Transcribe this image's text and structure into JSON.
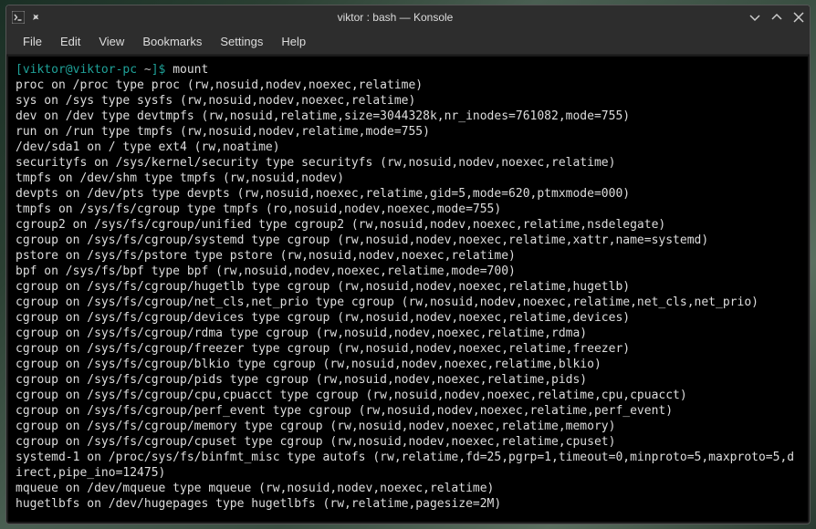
{
  "window": {
    "title": "viktor : bash — Konsole"
  },
  "menubar": {
    "items": [
      "File",
      "Edit",
      "View",
      "Bookmarks",
      "Settings",
      "Help"
    ]
  },
  "terminal": {
    "prompt": {
      "open_bracket": "[",
      "userhost": "viktor@viktor-pc",
      "space": " ",
      "cwd": "~",
      "close_bracket": "]",
      "symbol": "$"
    },
    "command": "mount",
    "lines": [
      "proc on /proc type proc (rw,nosuid,nodev,noexec,relatime)",
      "sys on /sys type sysfs (rw,nosuid,nodev,noexec,relatime)",
      "dev on /dev type devtmpfs (rw,nosuid,relatime,size=3044328k,nr_inodes=761082,mode=755)",
      "run on /run type tmpfs (rw,nosuid,nodev,relatime,mode=755)",
      "/dev/sda1 on / type ext4 (rw,noatime)",
      "securityfs on /sys/kernel/security type securityfs (rw,nosuid,nodev,noexec,relatime)",
      "tmpfs on /dev/shm type tmpfs (rw,nosuid,nodev)",
      "devpts on /dev/pts type devpts (rw,nosuid,noexec,relatime,gid=5,mode=620,ptmxmode=000)",
      "tmpfs on /sys/fs/cgroup type tmpfs (ro,nosuid,nodev,noexec,mode=755)",
      "cgroup2 on /sys/fs/cgroup/unified type cgroup2 (rw,nosuid,nodev,noexec,relatime,nsdelegate)",
      "cgroup on /sys/fs/cgroup/systemd type cgroup (rw,nosuid,nodev,noexec,relatime,xattr,name=systemd)",
      "pstore on /sys/fs/pstore type pstore (rw,nosuid,nodev,noexec,relatime)",
      "bpf on /sys/fs/bpf type bpf (rw,nosuid,nodev,noexec,relatime,mode=700)",
      "cgroup on /sys/fs/cgroup/hugetlb type cgroup (rw,nosuid,nodev,noexec,relatime,hugetlb)",
      "cgroup on /sys/fs/cgroup/net_cls,net_prio type cgroup (rw,nosuid,nodev,noexec,relatime,net_cls,net_prio)",
      "cgroup on /sys/fs/cgroup/devices type cgroup (rw,nosuid,nodev,noexec,relatime,devices)",
      "cgroup on /sys/fs/cgroup/rdma type cgroup (rw,nosuid,nodev,noexec,relatime,rdma)",
      "cgroup on /sys/fs/cgroup/freezer type cgroup (rw,nosuid,nodev,noexec,relatime,freezer)",
      "cgroup on /sys/fs/cgroup/blkio type cgroup (rw,nosuid,nodev,noexec,relatime,blkio)",
      "cgroup on /sys/fs/cgroup/pids type cgroup (rw,nosuid,nodev,noexec,relatime,pids)",
      "cgroup on /sys/fs/cgroup/cpu,cpuacct type cgroup (rw,nosuid,nodev,noexec,relatime,cpu,cpuacct)",
      "cgroup on /sys/fs/cgroup/perf_event type cgroup (rw,nosuid,nodev,noexec,relatime,perf_event)",
      "cgroup on /sys/fs/cgroup/memory type cgroup (rw,nosuid,nodev,noexec,relatime,memory)",
      "cgroup on /sys/fs/cgroup/cpuset type cgroup (rw,nosuid,nodev,noexec,relatime,cpuset)",
      "systemd-1 on /proc/sys/fs/binfmt_misc type autofs (rw,relatime,fd=25,pgrp=1,timeout=0,minproto=5,maxproto=5,direct,pipe_ino=12475)",
      "mqueue on /dev/mqueue type mqueue (rw,nosuid,nodev,noexec,relatime)",
      "hugetlbfs on /dev/hugepages type hugetlbfs (rw,relatime,pagesize=2M)"
    ]
  }
}
